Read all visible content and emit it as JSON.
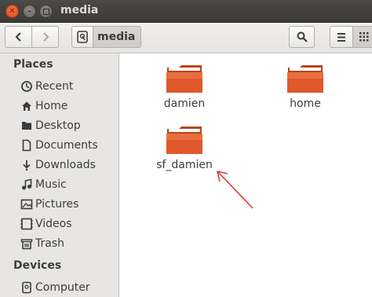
{
  "window": {
    "title": "media"
  },
  "toolbar": {
    "path": [
      {
        "label": "media"
      }
    ]
  },
  "sidebar": {
    "places_header": "Places",
    "places": [
      {
        "label": "Recent",
        "icon": "clock-icon"
      },
      {
        "label": "Home",
        "icon": "home-icon"
      },
      {
        "label": "Desktop",
        "icon": "desktop-icon"
      },
      {
        "label": "Documents",
        "icon": "document-icon"
      },
      {
        "label": "Downloads",
        "icon": "download-icon"
      },
      {
        "label": "Music",
        "icon": "music-icon"
      },
      {
        "label": "Pictures",
        "icon": "pictures-icon"
      },
      {
        "label": "Videos",
        "icon": "videos-icon"
      },
      {
        "label": "Trash",
        "icon": "trash-icon"
      }
    ],
    "devices_header": "Devices",
    "devices": [
      {
        "label": "Computer",
        "icon": "computer-icon"
      }
    ]
  },
  "content": {
    "folders": [
      {
        "label": "damien"
      },
      {
        "label": "home"
      },
      {
        "label": "sf_damien"
      }
    ]
  },
  "colors": {
    "folder_orange": "#e0582c",
    "annotation_arrow": "#e03030",
    "titlebar": "#3f3e3a"
  }
}
